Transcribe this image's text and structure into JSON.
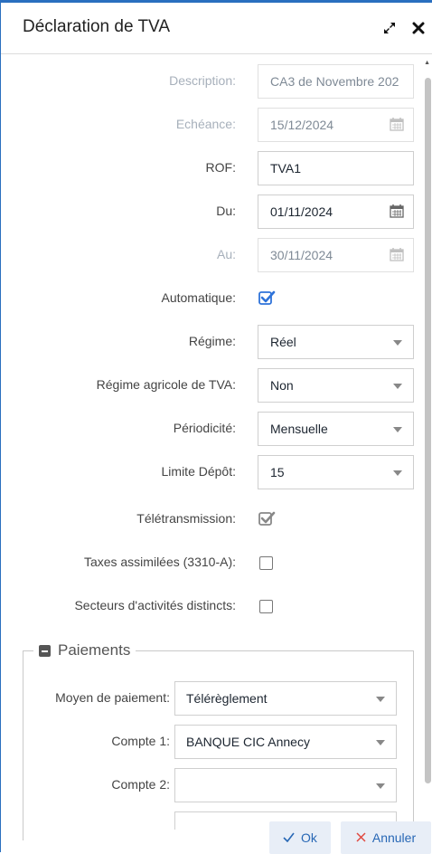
{
  "dialog": {
    "title": "Déclaration de TVA",
    "expand_icon": "expand-icon",
    "close_icon": "close-icon"
  },
  "form": {
    "description_label": "Description:",
    "description_value": "CA3 de Novembre 202",
    "echeance_label": "Echéance:",
    "echeance_value": "15/12/2024",
    "rof_label": "ROF:",
    "rof_value": "TVA1",
    "du_label": "Du:",
    "du_value": "01/11/2024",
    "au_label": "Au:",
    "au_value": "30/11/2024",
    "automatique_label": "Automatique:",
    "regime_label": "Régime:",
    "regime_value": "Réel",
    "regime_agricole_label": "Régime agricole de TVA:",
    "regime_agricole_value": "Non",
    "periodicite_label": "Périodicité:",
    "periodicite_value": "Mensuelle",
    "limite_depot_label": "Limite Dépôt:",
    "limite_depot_value": "15",
    "teletransmission_label": "Télétransmission:",
    "taxes_assimilees_label": "Taxes assimilées (3310-A):",
    "secteurs_label": "Secteurs d'activités distincts:"
  },
  "paiements": {
    "legend": "Paiements",
    "moyen_label": "Moyen de paiement:",
    "moyen_value": "Télérèglement",
    "compte1_label": "Compte 1:",
    "compte1_value": "BANQUE CIC Annecy",
    "compte2_label": "Compte 2:",
    "compte2_value": ""
  },
  "buttons": {
    "ok_label": "Ok",
    "cancel_label": "Annuler"
  },
  "colors": {
    "accent": "#2a6fbf",
    "button_bg": "#e8eef7",
    "check_blue": "#2f73d9"
  }
}
